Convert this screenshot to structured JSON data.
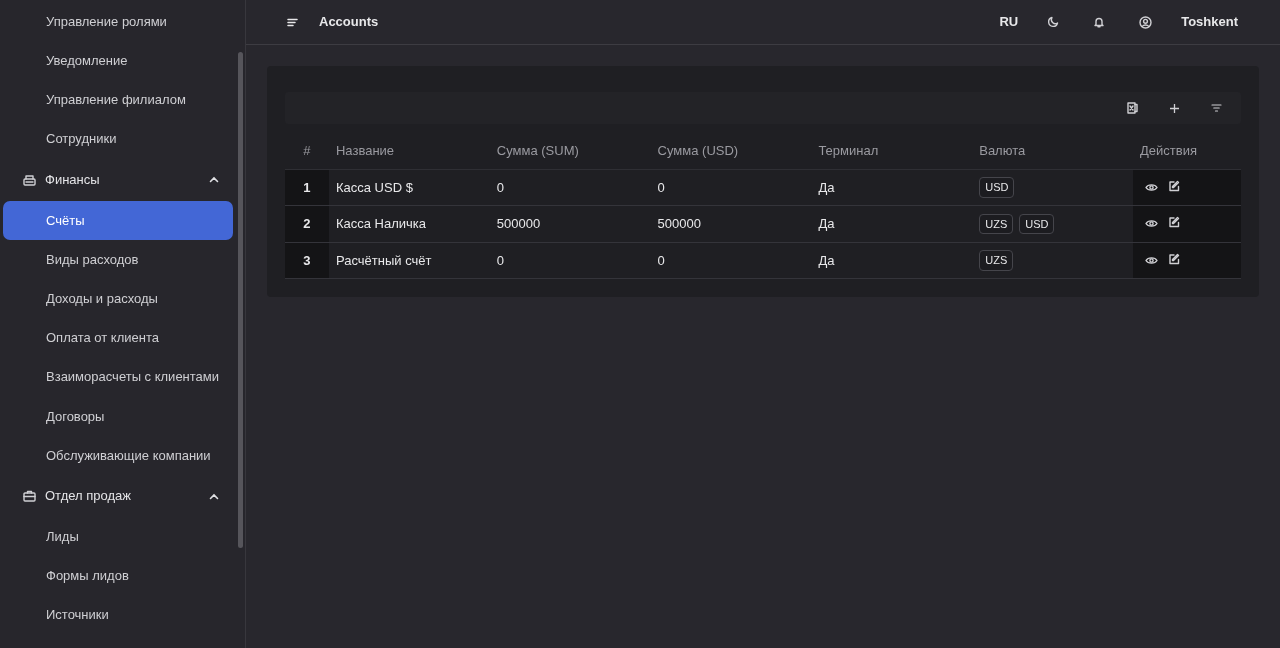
{
  "sidebar": {
    "items": [
      {
        "kind": "item",
        "label": "Управление ролями",
        "selected": false
      },
      {
        "kind": "item",
        "label": "Уведомление",
        "selected": false
      },
      {
        "kind": "item",
        "label": "Управление филиалом",
        "selected": false
      },
      {
        "kind": "item",
        "label": "Сотрудники",
        "selected": false
      },
      {
        "kind": "group",
        "label": "Финансы",
        "expanded": true,
        "children": [
          {
            "label": "Счёты",
            "selected": true
          },
          {
            "label": "Виды расходов",
            "selected": false
          },
          {
            "label": "Доходы и расходы",
            "selected": false
          },
          {
            "label": "Оплата от клиента",
            "selected": false
          },
          {
            "label": "Взаиморасчеты с клиентами",
            "selected": false
          },
          {
            "label": "Договоры",
            "selected": false
          },
          {
            "label": "Обслуживающие компании",
            "selected": false
          }
        ]
      },
      {
        "kind": "group",
        "label": "Отдел продаж",
        "expanded": true,
        "children": [
          {
            "label": "Лиды",
            "selected": false
          },
          {
            "label": "Формы лидов",
            "selected": false
          },
          {
            "label": "Источники",
            "selected": false
          }
        ]
      }
    ]
  },
  "header": {
    "title": "Accounts",
    "language": "RU",
    "user": "Toshkent"
  },
  "table": {
    "columns": [
      "#",
      "Название",
      "Сумма (SUM)",
      "Сумма (USD)",
      "Терминал",
      "Валюта",
      "Действия"
    ],
    "rows": [
      {
        "index": "1",
        "name": "Касса USD $",
        "sum_uzs": "0",
        "sum_usd": "0",
        "terminal": "Да",
        "currencies": [
          "USD"
        ]
      },
      {
        "index": "2",
        "name": "Касса Наличка",
        "sum_uzs": "500000",
        "sum_usd": "500000",
        "terminal": "Да",
        "currencies": [
          "UZS",
          "USD"
        ]
      },
      {
        "index": "3",
        "name": "Расчётный счёт",
        "sum_uzs": "0",
        "sum_usd": "0",
        "terminal": "Да",
        "currencies": [
          "UZS"
        ]
      }
    ]
  }
}
